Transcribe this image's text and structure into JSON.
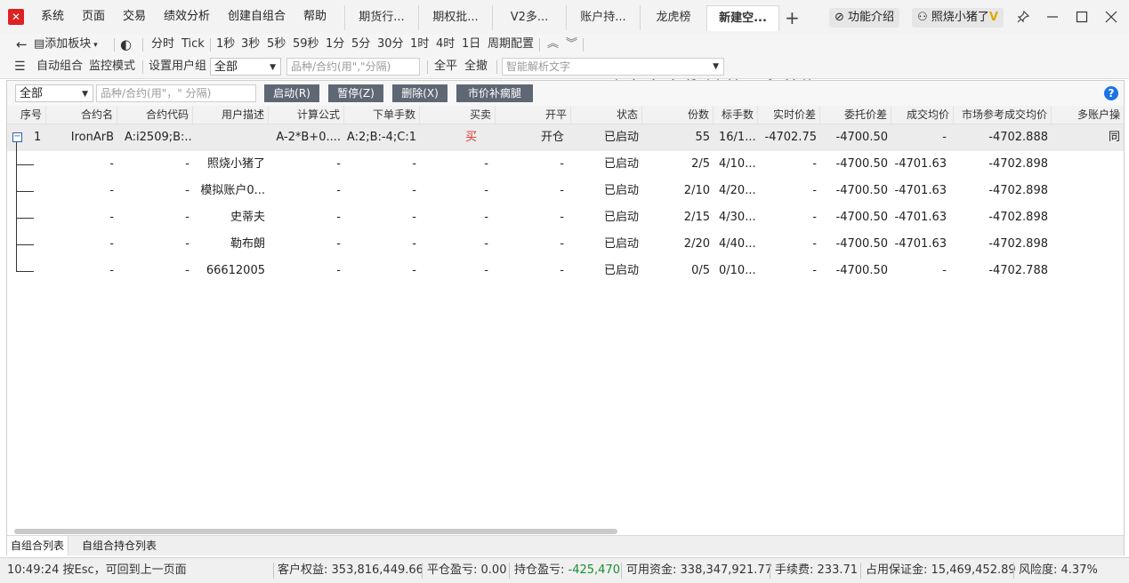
{
  "titlebar": {
    "menus": [
      "系统",
      "页面",
      "交易",
      "绩效分析",
      "创建自组合",
      "帮助"
    ],
    "tabs": [
      "期货行...",
      "期权批...",
      "V2多...",
      "账户持...",
      "龙虎榜",
      "新建空..."
    ],
    "active_tab_index": 5,
    "add_tab": "+",
    "feature_intro": "功能介绍",
    "user": "照烧小猪了",
    "user_badge": "V"
  },
  "toolbar1": {
    "add_block": "添加板块",
    "periods": [
      "分时",
      "Tick",
      "1秒",
      "3秒",
      "5秒",
      "59秒",
      "1分",
      "5分",
      "30分",
      "1时",
      "4时",
      "1日",
      "周期配置"
    ]
  },
  "toolbar2": {
    "auto_combo": "自动组合",
    "monitor_mode": "监控模式",
    "set_user_group": "设置用户组",
    "group_value": "全部",
    "contract_placeholder": "品种/合约(用\",\"分隔)",
    "close_all": "全平",
    "cancel_all": "全撤",
    "smart_parse_placeholder": "智能解析文字"
  },
  "panel": {
    "filter_value": "全部",
    "filter_placeholder": "品种/合约(用\"，\" 分隔)",
    "buttons": [
      "启动(R)",
      "暂停(Z)",
      "删除(X)",
      "市价补瘸腿"
    ],
    "help": "?",
    "columns": [
      "序号",
      "合约名",
      "合约代码",
      "用户描述",
      "计算公式",
      "下单手数",
      "买卖",
      "开平",
      "状态",
      "份数",
      "标手数",
      "实时价差",
      "委托价差",
      "成交均价",
      "市场参考成交均价",
      "多账户操"
    ],
    "parent_row": {
      "index": "1",
      "name": "IronArB",
      "code": "A:i2509;B:...",
      "desc": "",
      "formula": "A-2*B+0....",
      "lots": "A:2;B:-4;C:1",
      "side": "买",
      "open_close": "开仓",
      "status": "已启动",
      "shares": "55",
      "std_lots": "16/1...",
      "realtime_spread": "-4702.75",
      "order_spread": "-4700.50",
      "avg_price": "-",
      "ref_avg_price": "-4702.888",
      "multi": "同"
    },
    "child_rows": [
      {
        "name": "-",
        "code": "-",
        "desc": "照烧小猪了",
        "formula": "-",
        "lots": "-",
        "side": "-",
        "open_close": "-",
        "status": "已启动",
        "shares": "2/5",
        "std_lots": "4/10...",
        "realtime_spread": "-",
        "order_spread": "-4700.50",
        "avg_price": "-4701.63",
        "ref_avg_price": "-4702.898"
      },
      {
        "name": "-",
        "code": "-",
        "desc": "模拟账户0...",
        "formula": "-",
        "lots": "-",
        "side": "-",
        "open_close": "-",
        "status": "已启动",
        "shares": "2/10",
        "std_lots": "4/20...",
        "realtime_spread": "-",
        "order_spread": "-4700.50",
        "avg_price": "-4701.63",
        "ref_avg_price": "-4702.898"
      },
      {
        "name": "-",
        "code": "-",
        "desc": "史蒂夫",
        "formula": "-",
        "lots": "-",
        "side": "-",
        "open_close": "-",
        "status": "已启动",
        "shares": "2/15",
        "std_lots": "4/30...",
        "realtime_spread": "-",
        "order_spread": "-4700.50",
        "avg_price": "-4701.63",
        "ref_avg_price": "-4702.898"
      },
      {
        "name": "-",
        "code": "-",
        "desc": "勒布朗",
        "formula": "-",
        "lots": "-",
        "side": "-",
        "open_close": "-",
        "status": "已启动",
        "shares": "2/20",
        "std_lots": "4/40...",
        "realtime_spread": "-",
        "order_spread": "-4700.50",
        "avg_price": "-4701.63",
        "ref_avg_price": "-4702.898"
      },
      {
        "name": "-",
        "code": "-",
        "desc": "66612005",
        "formula": "-",
        "lots": "-",
        "side": "-",
        "open_close": "-",
        "status": "已启动",
        "shares": "0/5",
        "std_lots": "0/10...",
        "realtime_spread": "-",
        "order_spread": "-4700.50",
        "avg_price": "-",
        "ref_avg_price": "-4702.788"
      }
    ],
    "bottom_tabs": [
      "自组合列表",
      "自组合持仓列表"
    ]
  },
  "statusbar": {
    "hint": "10:49:24 按Esc，可回到上一页面",
    "equity_label": "客户权益:",
    "equity": "353,816,449.66",
    "close_pnl_label": "平仓盈亏:",
    "close_pnl": "0.00",
    "hold_pnl_label": "持仓盈亏:",
    "hold_pnl": "-425,470",
    "available_label": "可用资金:",
    "available": "338,347,921.77",
    "fee_label": "手续费:",
    "fee": "233.71",
    "margin_label": "占用保证金:",
    "margin": "15,469,452.89",
    "risk_label": "风险度:",
    "risk": "4.37%"
  },
  "colors": {
    "sell_red": "#e03030",
    "pnl_green": "#1a8f2e",
    "button_bg": "#5f6775",
    "help_blue": "#1a73e8"
  }
}
